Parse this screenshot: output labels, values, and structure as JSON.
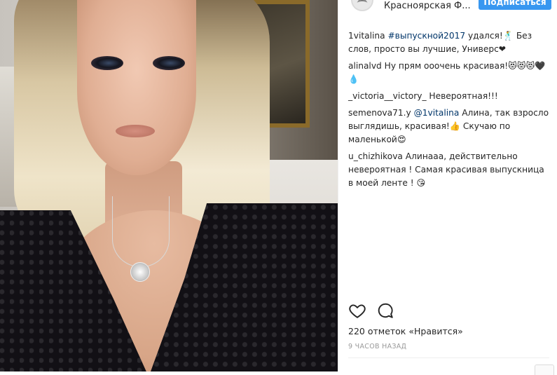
{
  "header": {
    "account_name": "Красноярская Ф...",
    "follow_label": "Подписаться"
  },
  "post": {
    "caption": {
      "user": "1vitalina",
      "hashtag": "#выпускной2017",
      "text": "удался!🕺 Без слов, просто вы лучшие, Универс❤"
    },
    "comments": [
      {
        "user": "alinalvd",
        "text": "Ну прям ооочень красивая!😻😻😻🖤💧"
      },
      {
        "user": "_victoria__victory_",
        "text": "Невероятная!!!"
      },
      {
        "user": "semenova71.y",
        "mention": "@1vitalina",
        "text": "Алина, так взросло выглядишь, красивая!👍 Скучаю по маленькой😍"
      },
      {
        "user": "u_chizhikova",
        "text": "Алинааа, действительно невероятная ! Самая красивая выпускница в моей ленте ! 😘"
      }
    ],
    "likes_text": "220 отметок «Нравится»",
    "time_text": "9 ЧАСОВ НАЗАД"
  },
  "icons": {
    "like": "heart-icon",
    "comment": "comment-icon",
    "avatar": "account-avatar"
  },
  "colors": {
    "follow_button": "#3897f0",
    "text": "#262626",
    "muted": "#999999",
    "link": "#003569"
  }
}
